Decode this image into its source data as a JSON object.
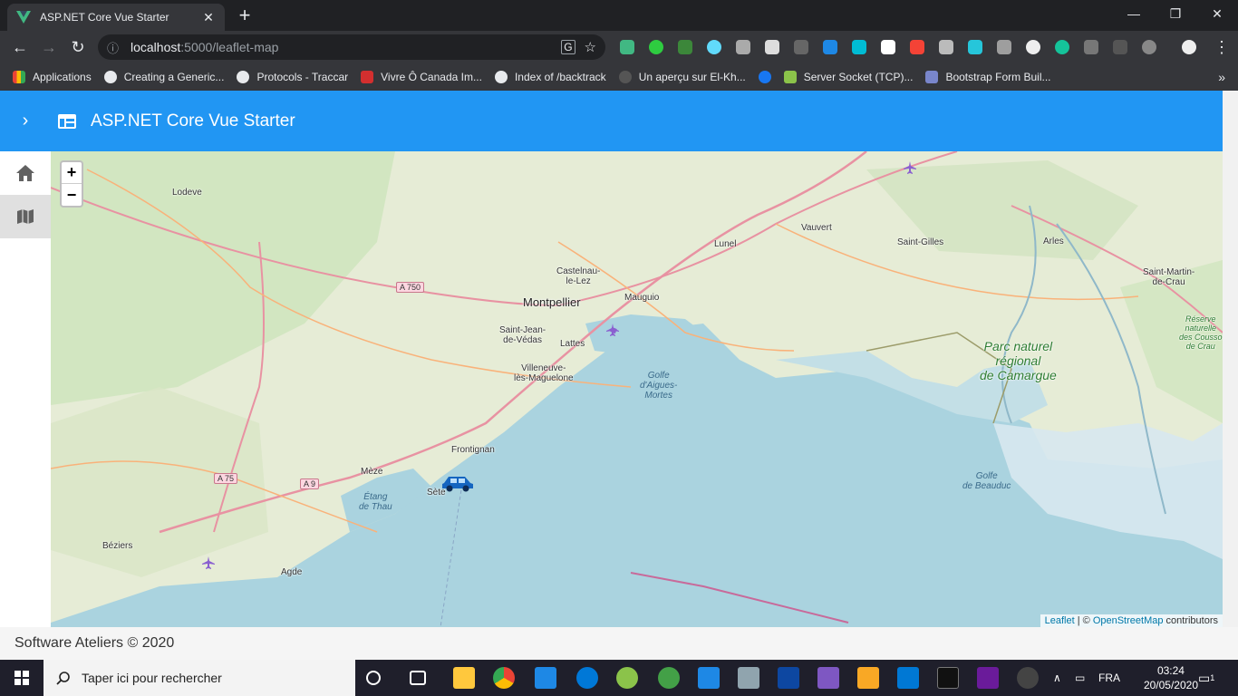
{
  "browser": {
    "tab_title": "ASP.NET Core Vue Starter",
    "url_host": "localhost",
    "url_path": ":5000/leaflet-map",
    "bookmarks": [
      {
        "label": "Applications",
        "color": "#e8eaed"
      },
      {
        "label": "Creating a Generic...",
        "color": "#e8eaed"
      },
      {
        "label": "Protocols - Traccar",
        "color": "#e8eaed"
      },
      {
        "label": "Vivre Ô Canada Im...",
        "color": "#d32f2f"
      },
      {
        "label": "Index of /backtrack",
        "color": "#e8eaed"
      },
      {
        "label": "Un aperçu sur El-Kh...",
        "color": "#555"
      },
      {
        "label": "",
        "color": "#1877f2"
      },
      {
        "label": "Server Socket (TCP)...",
        "color": "#8bc34a"
      },
      {
        "label": "Bootstrap Form Buil...",
        "color": "#7986cb"
      }
    ]
  },
  "app": {
    "title": "ASP.NET Core Vue Starter",
    "footer": "Software Ateliers © 2020",
    "sidebar": [
      {
        "icon": "home-icon",
        "active": false
      },
      {
        "icon": "map-icon",
        "active": true
      }
    ]
  },
  "map": {
    "zoom_in": "+",
    "zoom_out": "−",
    "attribution_leaflet": "Leaflet",
    "attribution_sep": " | © ",
    "attribution_osm": "OpenStreetMap",
    "attribution_tail": " contributors",
    "labels": {
      "lodeve": "Lodeve",
      "lunel": "Lunel",
      "vauvert": "Vauvert",
      "saint_gilles": "Saint-Gilles",
      "arles": "Arles",
      "saint_martin": "Saint-Martin-\nde-Crau",
      "castelnau": "Castelnau-\nle-Lez",
      "montpellier": "Montpellier",
      "mauguio": "Mauguio",
      "saint_jean": "Saint-Jean-\nde-Védas",
      "lattes": "Lattes",
      "villeneuve": "Villeneuve-\nlès-Maguelone",
      "golfe_aigues": "Golfe\nd'Aigues-\nMortes",
      "parc": "Parc naturel\nrégional\nde Camargue",
      "reserve": "Réserve\nnaturelle\ndes Cousso\nde Crau",
      "frontignan": "Frontignan",
      "meze": "Mèze",
      "sete": "Sète",
      "etang_thau": "Étang\nde Thau",
      "golfe_beauduc": "Golfe\nde Beauduc",
      "beziers": "Béziers",
      "agde": "Agde"
    },
    "roads": {
      "a750": "A 750",
      "a75": "A 75",
      "a9": "A 9"
    }
  },
  "taskbar": {
    "search_placeholder": "Taper ici pour rechercher",
    "language": "FRA",
    "time": "03:24",
    "date": "20/05/2020",
    "notifications": "1"
  }
}
